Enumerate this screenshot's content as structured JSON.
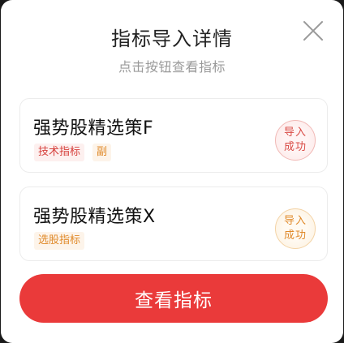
{
  "dialog": {
    "title": "指标导入详情",
    "subtitle": "点击按钮查看指标",
    "close_icon": "close-icon"
  },
  "items": [
    {
      "name": "强势股精选策F",
      "tags": [
        "技术指标",
        "副"
      ],
      "status": [
        "导入",
        "成功"
      ],
      "accent": "#d94b45"
    },
    {
      "name": "强势股精选策X",
      "tags": [
        "选股指标"
      ],
      "status": [
        "导入",
        "成功"
      ],
      "accent": "#e08a2a"
    }
  ],
  "footer": {
    "button_label": "查看指标",
    "button_color": "#ea3a3a"
  }
}
